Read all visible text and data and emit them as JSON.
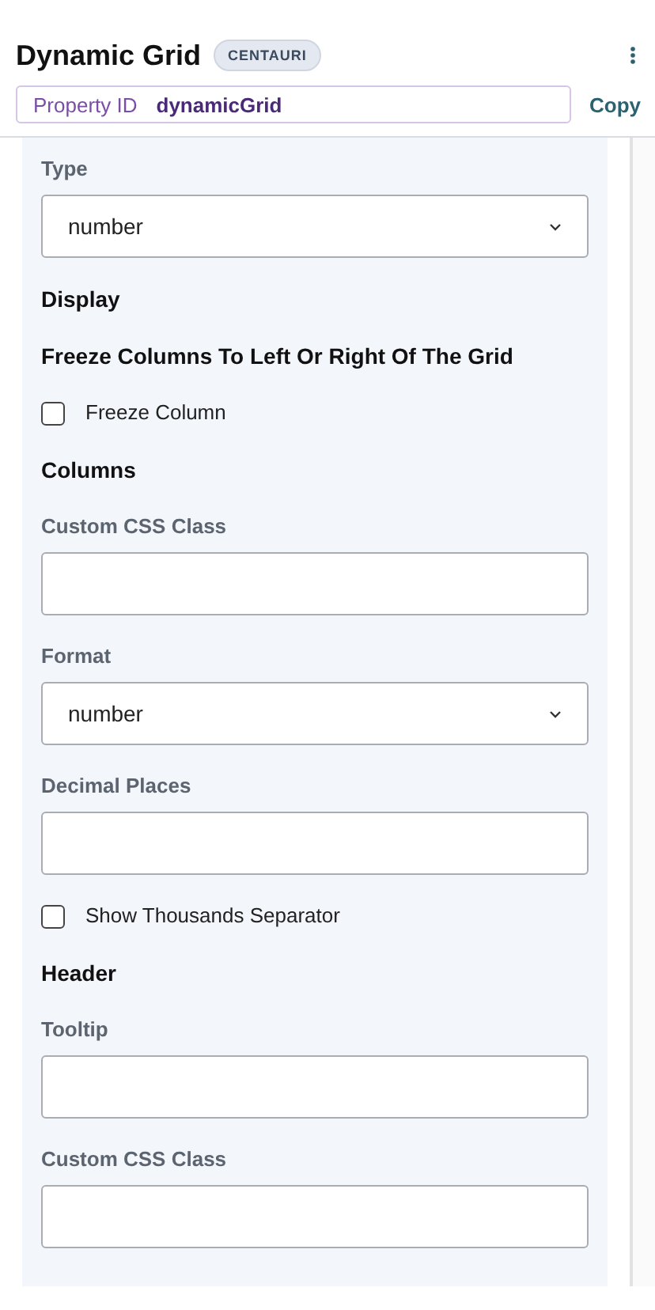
{
  "header": {
    "title": "Dynamic Grid",
    "badge": "CENTAURI"
  },
  "property": {
    "label": "Property ID",
    "value": "dynamicGrid",
    "action": "Copy"
  },
  "items": [
    {
      "kind": "label",
      "text": "Type"
    },
    {
      "kind": "select",
      "value": "number"
    },
    {
      "kind": "heading",
      "text": "Display"
    },
    {
      "kind": "heading",
      "text": "Freeze Columns To Left Or Right Of The Grid"
    },
    {
      "kind": "checkbox",
      "text": "Freeze Column",
      "checked": false
    },
    {
      "kind": "heading",
      "text": "Columns"
    },
    {
      "kind": "label",
      "text": "Custom CSS Class"
    },
    {
      "kind": "input",
      "value": ""
    },
    {
      "kind": "label",
      "text": "Format"
    },
    {
      "kind": "select",
      "value": "number"
    },
    {
      "kind": "label",
      "text": "Decimal Places"
    },
    {
      "kind": "input",
      "value": ""
    },
    {
      "kind": "checkbox",
      "text": "Show Thousands Separator",
      "checked": false
    },
    {
      "kind": "heading",
      "text": "Header"
    },
    {
      "kind": "label",
      "text": "Tooltip"
    },
    {
      "kind": "input",
      "value": ""
    },
    {
      "kind": "label",
      "text": "Custom CSS Class"
    },
    {
      "kind": "input",
      "value": ""
    }
  ]
}
